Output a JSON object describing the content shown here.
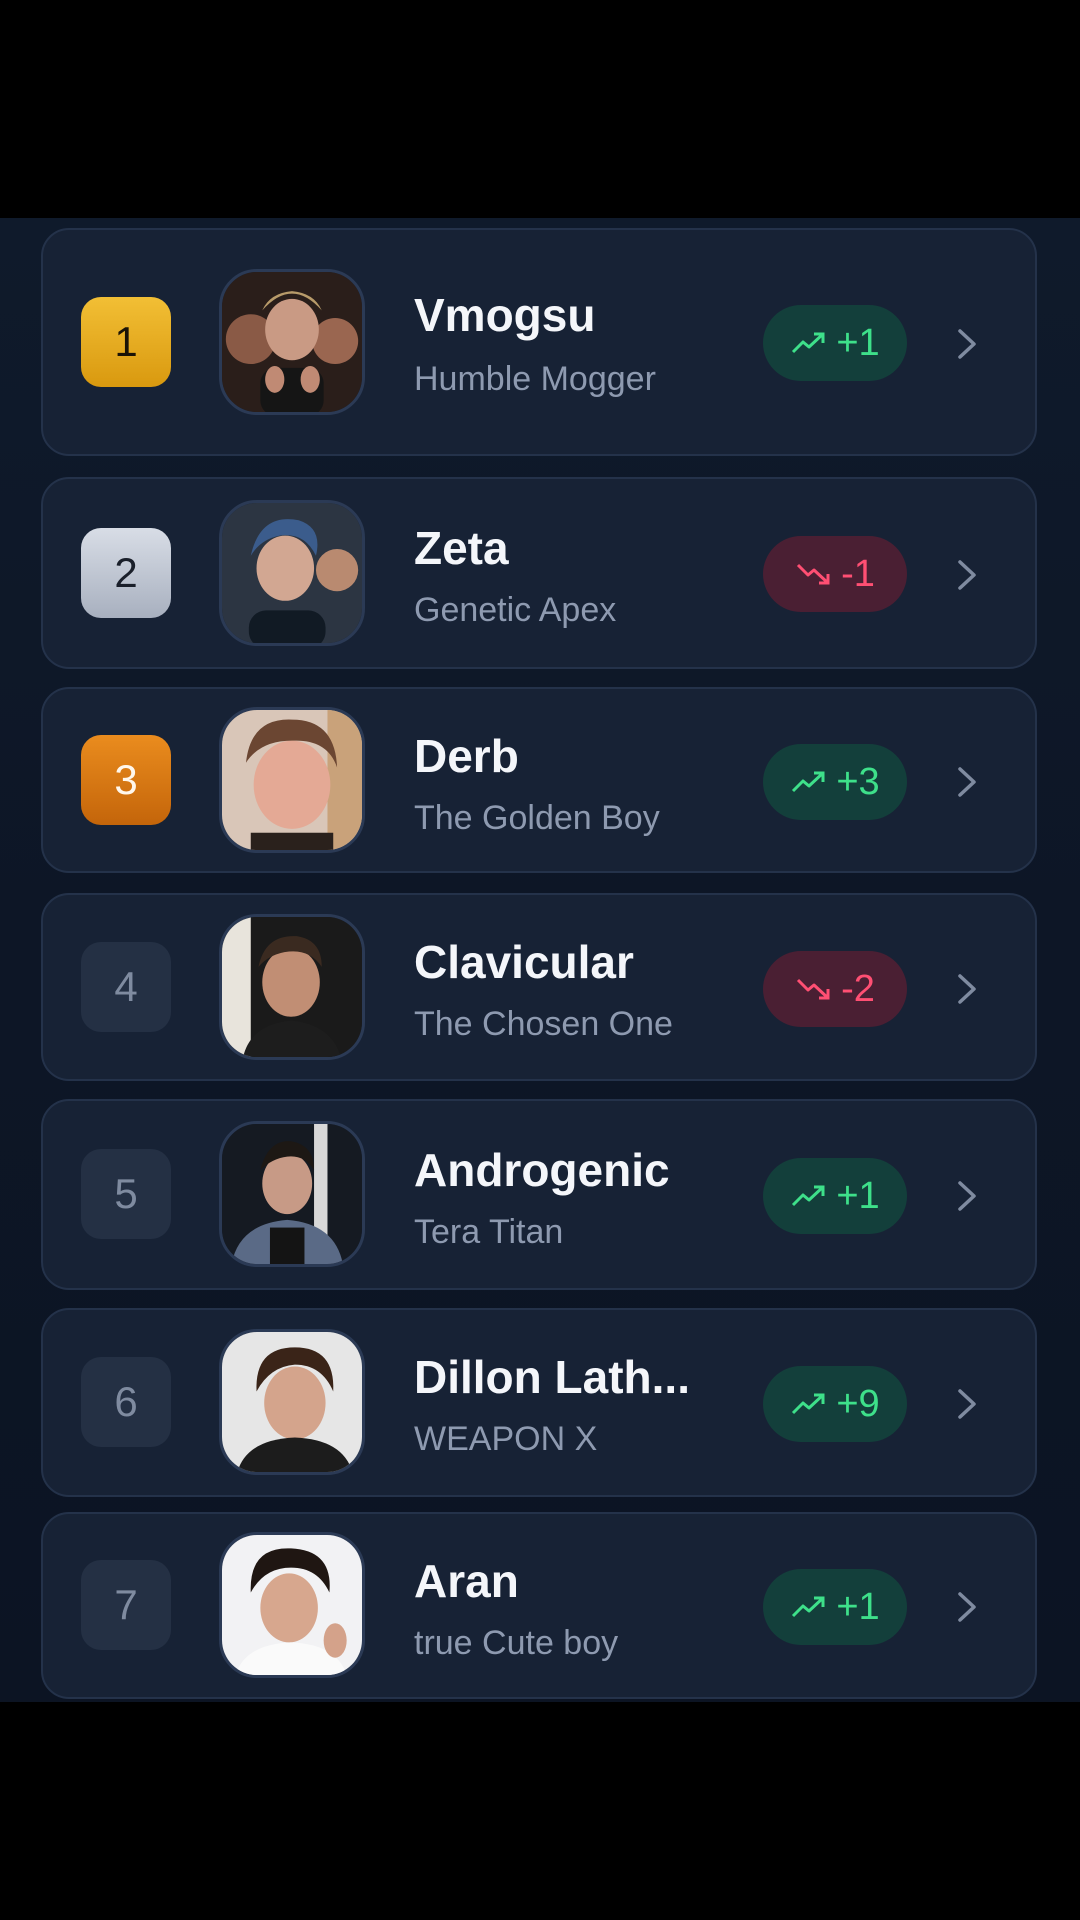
{
  "leaderboard": {
    "rows": [
      {
        "rank": "1",
        "name": "Vmogsu",
        "subtitle": "Humble Mogger",
        "change": "+1",
        "direction": "up",
        "rank_style": "gold"
      },
      {
        "rank": "2",
        "name": "Zeta",
        "subtitle": "Genetic Apex",
        "change": "-1",
        "direction": "down",
        "rank_style": "silver"
      },
      {
        "rank": "3",
        "name": "Derb",
        "subtitle": "The Golden Boy",
        "change": "+3",
        "direction": "up",
        "rank_style": "bronze"
      },
      {
        "rank": "4",
        "name": "Clavicular",
        "subtitle": "The Chosen One",
        "change": "-2",
        "direction": "down",
        "rank_style": "plain"
      },
      {
        "rank": "5",
        "name": "Androgenic",
        "subtitle": "Tera Titan",
        "change": "+1",
        "direction": "up",
        "rank_style": "plain"
      },
      {
        "rank": "6",
        "name": "Dillon Lath...",
        "subtitle": "WEAPON X",
        "change": "+9",
        "direction": "up",
        "rank_style": "plain"
      },
      {
        "rank": "7",
        "name": "Aran",
        "subtitle": "true Cute boy",
        "change": "+1",
        "direction": "up",
        "rank_style": "plain"
      }
    ]
  },
  "icons": {
    "trend_up": "trending-up-icon",
    "trend_down": "trending-down-icon",
    "chevron": "chevron-right-icon"
  },
  "colors": {
    "up_text": "#3ee08a",
    "up_bg": "#133f3b",
    "down_text": "#ff4f73",
    "down_bg": "#4a1f33",
    "gold": "#e8ad1f",
    "silver": "#c3c9d4",
    "bronze": "#d97816"
  }
}
